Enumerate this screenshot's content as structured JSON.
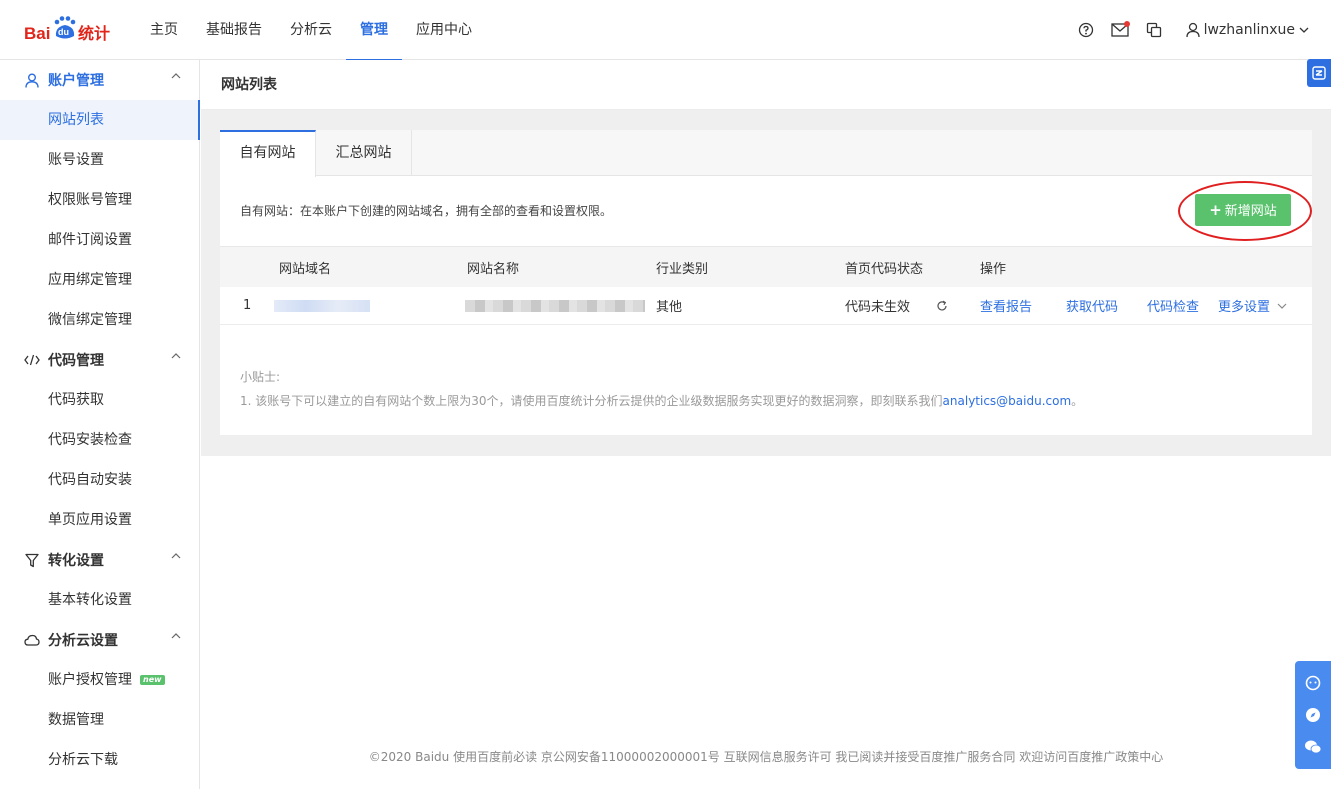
{
  "logo": {
    "text_bai": "Bai",
    "text_du": "du",
    "text_tongji": "统计"
  },
  "nav": [
    {
      "label": "主页"
    },
    {
      "label": "基础报告"
    },
    {
      "label": "分析云"
    },
    {
      "label": "管理",
      "active": true
    },
    {
      "label": "应用中心"
    }
  ],
  "user": {
    "name": "lwzhanlinxue"
  },
  "sidebar": {
    "groups": [
      {
        "label": "账户管理",
        "icon": "user-icon",
        "active": true,
        "items": [
          "网站列表",
          "账号设置",
          "权限账号管理",
          "邮件订阅设置",
          "应用绑定管理",
          "微信绑定管理"
        ]
      },
      {
        "label": "代码管理",
        "icon": "code-icon",
        "items": [
          "代码获取",
          "代码安装检查",
          "代码自动安装",
          "单页应用设置"
        ]
      },
      {
        "label": "转化设置",
        "icon": "funnel-icon",
        "items": [
          "基本转化设置"
        ]
      },
      {
        "label": "分析云设置",
        "icon": "cloud-icon",
        "items": [
          "账户授权管理",
          "数据管理",
          "分析云下载"
        ]
      }
    ],
    "new_badge": "new"
  },
  "page": {
    "title": "网站列表"
  },
  "tabs": [
    {
      "label": "自有网站",
      "active": true
    },
    {
      "label": "汇总网站"
    }
  ],
  "description": "自有网站：在本账户下创建的网站域名，拥有全部的查看和设置权限。",
  "add_button": {
    "label": "新增网站"
  },
  "table": {
    "headers": [
      "网站域名",
      "网站名称",
      "行业类别",
      "首页代码状态",
      "操作"
    ],
    "rows": [
      {
        "index": "1",
        "industry": "其他",
        "status": "代码未生效",
        "actions": [
          "查看报告",
          "获取代码",
          "代码检查",
          "更多设置"
        ]
      }
    ]
  },
  "tips": {
    "title": "小贴士:",
    "line1_prefix": "1. 该账号下可以建立的自有网站个数上限为30个，请使用百度统计分析云提供的企业级数据服务实现更好的数据洞察，即刻联系我们",
    "email": "analytics@baidu.com",
    "line1_suffix": "。"
  },
  "footer": "©2020 Baidu 使用百度前必读 京公网安备11000002000001号 互联网信息服务许可 我已阅读并接受百度推广服务合同 欢迎访问百度推广政策中心",
  "colors": {
    "accent": "#2d6fe0",
    "green": "#5ac26d",
    "highlight_circle": "#e02020"
  }
}
